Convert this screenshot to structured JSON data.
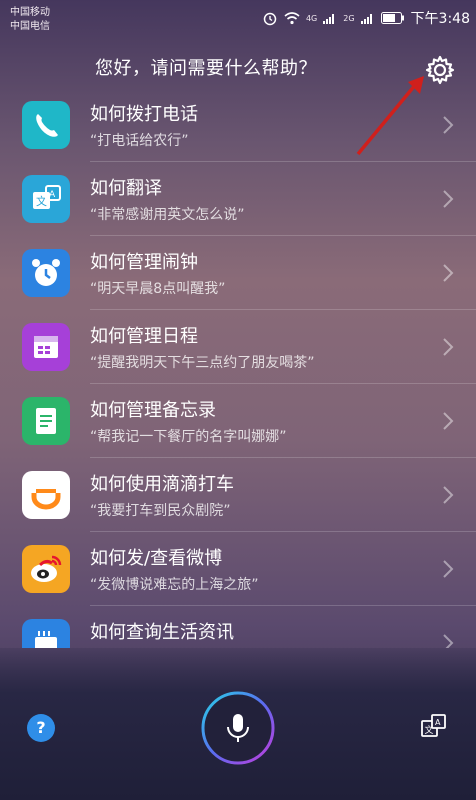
{
  "status": {
    "carrier1": "中国移动",
    "carrier2": "中国电信",
    "sig1": "4G",
    "sig2": "2G",
    "time": "下午3:48"
  },
  "header": {
    "title": "您好，请问需要什么帮助？"
  },
  "items": [
    {
      "title": "如何拨打电话",
      "subtitle": "“打电话给农行”",
      "icon": "phone-icon",
      "color": "#1fb7c8"
    },
    {
      "title": "如何翻译",
      "subtitle": "“非常感谢用英文怎么说”",
      "icon": "translate-icon",
      "color": "#2aa6d8"
    },
    {
      "title": "如何管理闹钟",
      "subtitle": "“明天早晨8点叫醒我”",
      "icon": "alarm-clock-icon",
      "color": "#2c83e1"
    },
    {
      "title": "如何管理日程",
      "subtitle": "“提醒我明天下午三点约了朋友喝茶”",
      "icon": "calendar-icon",
      "color": "#a640d8"
    },
    {
      "title": "如何管理备忘录",
      "subtitle": "“帮我记一下餐厅的名字叫娜娜”",
      "icon": "notepad-icon",
      "color": "#2bb56a"
    },
    {
      "title": "如何使用滴滴打车",
      "subtitle": "“我要打车到民众剧院”",
      "icon": "didi-icon",
      "color": "#ff8a1a"
    },
    {
      "title": "如何发/查看微博",
      "subtitle": "“发微博说难忘的上海之旅”",
      "icon": "weibo-icon",
      "color": "#f5a623"
    },
    {
      "title": "如何查询生活资讯",
      "subtitle": "",
      "icon": "info-icon",
      "color": "#2c83e1"
    }
  ],
  "bottom": {
    "help_symbol": "?"
  }
}
